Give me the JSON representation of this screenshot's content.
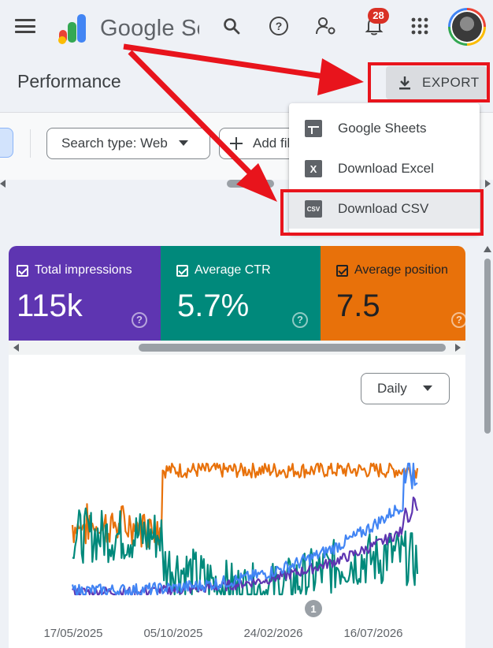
{
  "app": {
    "name": "Google Search Console",
    "logo_text": "Google Search Console"
  },
  "header": {
    "notifications_count": "28"
  },
  "page": {
    "title": "Performance"
  },
  "toolbar": {
    "export_label": "EXPORT"
  },
  "filters": {
    "search_type_chip": "Search type: Web",
    "add_filter_chip": "Add filter"
  },
  "export_menu": {
    "items": [
      {
        "label": "Google Sheets",
        "icon": "sheets-icon",
        "icon_text": ""
      },
      {
        "label": "Download Excel",
        "icon": "excel-icon",
        "icon_text": "X"
      },
      {
        "label": "Download CSV",
        "icon": "csv-icon",
        "icon_text": "CSV"
      }
    ]
  },
  "metrics": [
    {
      "label": "Total impressions",
      "value": "115k",
      "color": "#5e35b1"
    },
    {
      "label": "Average CTR",
      "value": "5.7%",
      "color": "#00897b"
    },
    {
      "label": "Average position",
      "value": "7.5",
      "color": "#e8710a"
    }
  ],
  "chart": {
    "granularity_label": "Daily",
    "annotation_marker": "1"
  },
  "chart_data": {
    "type": "line",
    "x_tick_labels": [
      "17/05/2025",
      "05/10/2025",
      "24/02/2026",
      "16/07/2026"
    ],
    "series": [
      {
        "color": "#e8710a",
        "start": 0.4,
        "jump_at": 0.26,
        "after": 0.95,
        "noise": 0.06
      },
      {
        "color": "#00897b",
        "start": 0.45,
        "jump_at": 0.26,
        "after": 0.15,
        "noise": 0.15
      },
      {
        "color": "#5e35b1",
        "start": 0.02,
        "end": 0.55,
        "noise": 0.04
      },
      {
        "color": "#4285f4",
        "start": 0.03,
        "end": 0.78,
        "noise": 0.05
      }
    ],
    "grid": false
  },
  "colors": {
    "annotation_red": "#e8141c",
    "accent_blue": "#4285f4"
  }
}
